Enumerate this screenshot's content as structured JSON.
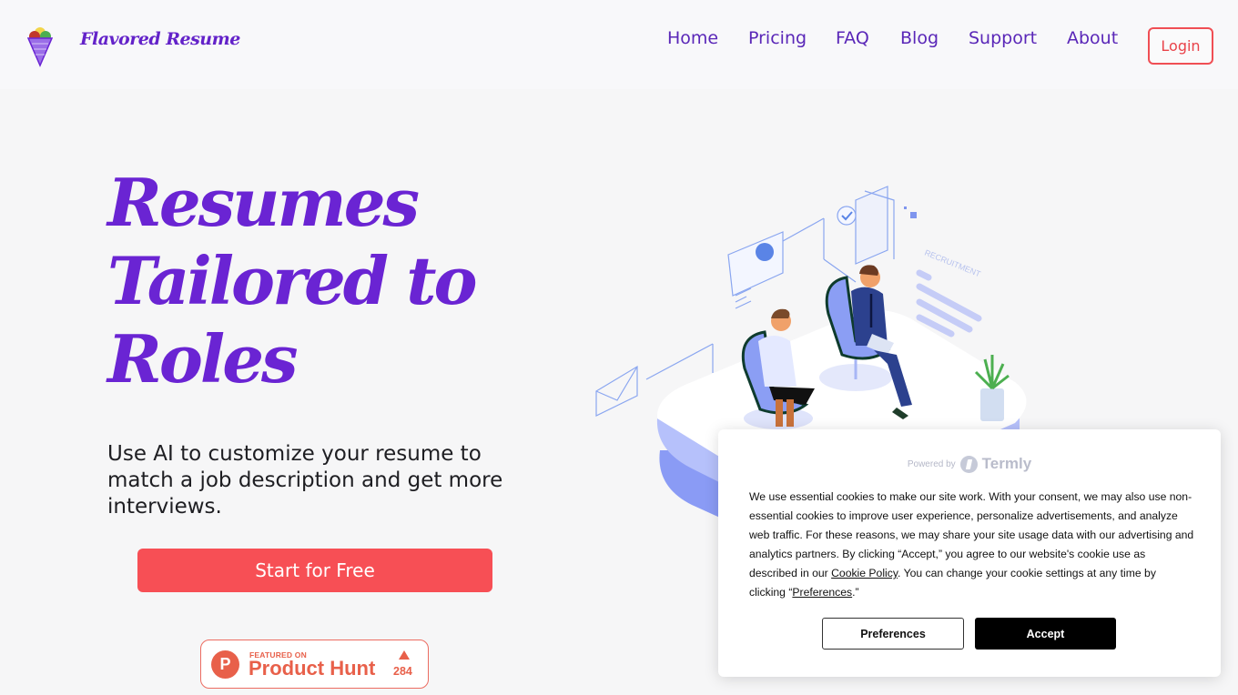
{
  "header": {
    "brand": "Flavored Resume",
    "nav": [
      {
        "label": "Home"
      },
      {
        "label": "Pricing"
      },
      {
        "label": "FAQ"
      },
      {
        "label": "Blog"
      },
      {
        "label": "Support"
      },
      {
        "label": "About"
      }
    ],
    "login_label": "Login"
  },
  "hero": {
    "title_lines": [
      "Resumes",
      "Tailored to",
      "Roles"
    ],
    "subtitle": "Use AI to customize your resume to match a job description and get more interviews.",
    "cta_label": "Start for Free"
  },
  "product_hunt": {
    "logo_letter": "P",
    "featured": "FEATURED ON",
    "name": "Product Hunt",
    "upvotes": "284"
  },
  "illustration": {
    "label": "RECRUITMENT"
  },
  "cookie_banner": {
    "powered_by": "Powered by",
    "provider": "Termly",
    "text_part1": "We use essential cookies to make our site work. With your consent, we may also use non-essential cookies to improve user experience, personalize advertisements, and analyze web traffic. For these reasons, we may share your site usage data with our advertising and analytics partners. By clicking “Accept,” you agree to our website's cookie use as described in our ",
    "cookie_policy_link": "Cookie Policy",
    "text_part2": ". You can change your cookie settings at any time by clicking “",
    "preferences_link": "Preferences",
    "text_part3": ".”",
    "preferences_button": "Preferences",
    "accept_button": "Accept"
  },
  "colors": {
    "brand_purple": "#6a24d3",
    "nav_purple": "#5a27b8",
    "cta_red": "#f74f55",
    "product_hunt": "#e8604a"
  }
}
